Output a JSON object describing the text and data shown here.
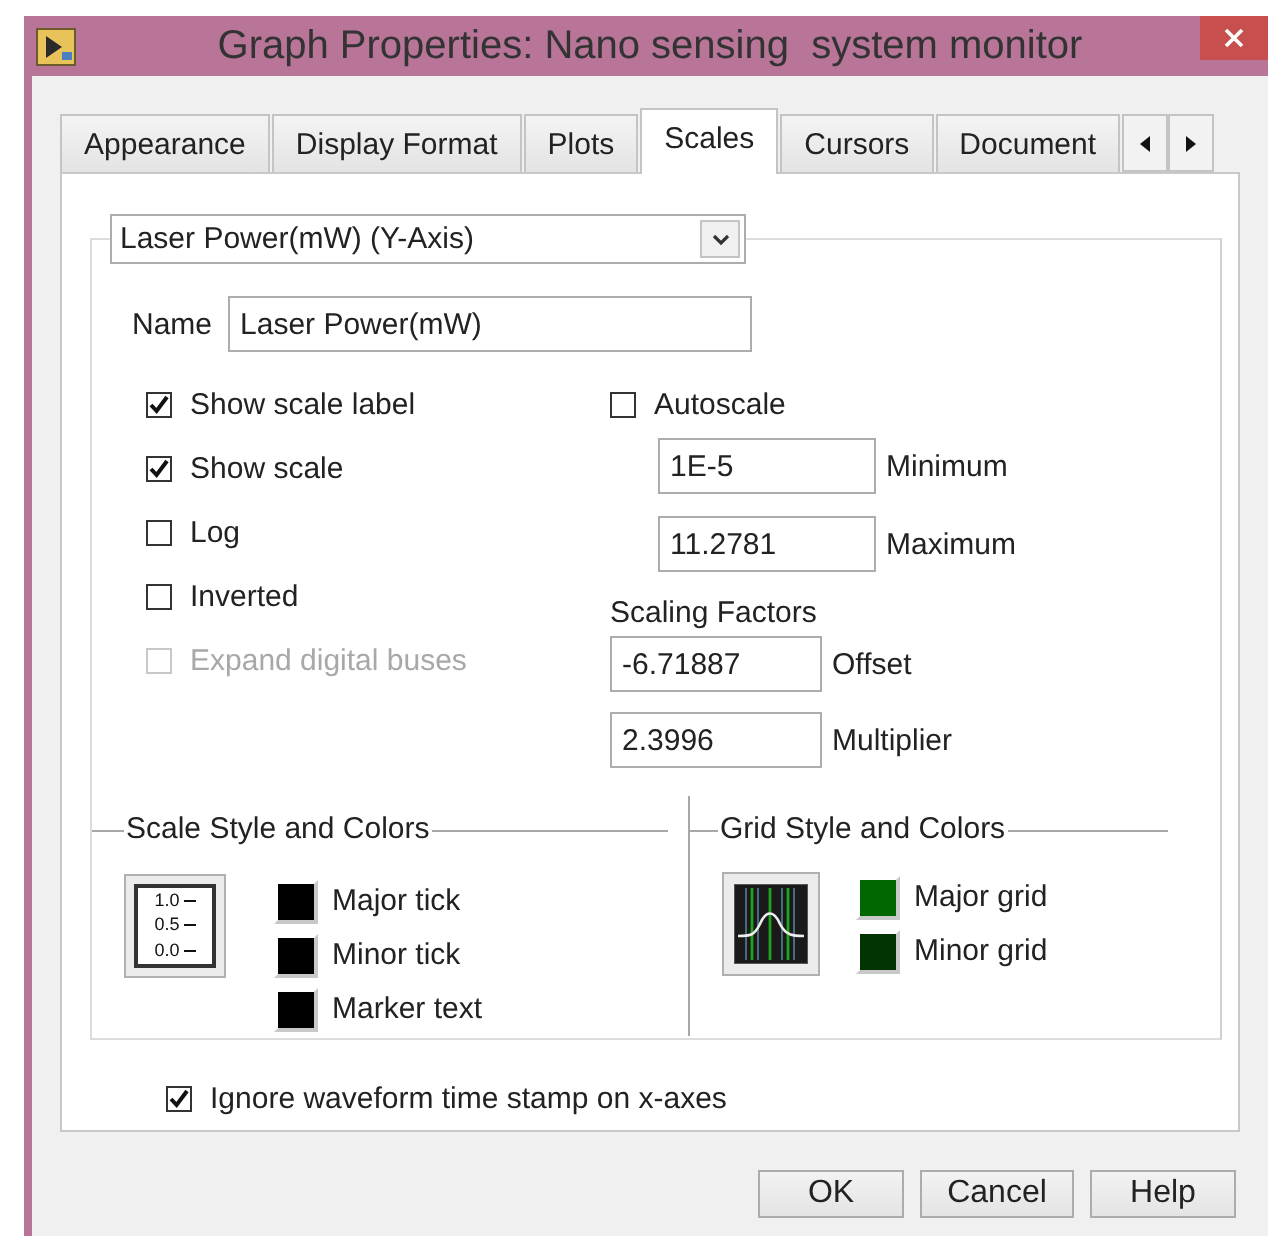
{
  "window": {
    "title": "Graph Properties: Nano sensing  system monitor"
  },
  "tabs": [
    {
      "label": "Appearance",
      "selected": false
    },
    {
      "label": "Display Format",
      "selected": false
    },
    {
      "label": "Plots",
      "selected": false
    },
    {
      "label": "Scales",
      "selected": true
    },
    {
      "label": "Cursors",
      "selected": false
    },
    {
      "label": "Document",
      "selected": false
    }
  ],
  "axis_select": {
    "value": "Laser Power(mW) (Y-Axis)"
  },
  "name": {
    "label": "Name",
    "value": "Laser Power(mW)"
  },
  "options": [
    {
      "label": "Show scale label",
      "checked": true,
      "disabled": false
    },
    {
      "label": "Show scale",
      "checked": true,
      "disabled": false
    },
    {
      "label": "Log",
      "checked": false,
      "disabled": false
    },
    {
      "label": "Inverted",
      "checked": false,
      "disabled": false
    },
    {
      "label": "Expand digital buses",
      "checked": false,
      "disabled": true
    }
  ],
  "autoscale": {
    "label": "Autoscale",
    "checked": false
  },
  "range": [
    {
      "value": "1E-5",
      "label": "Minimum"
    },
    {
      "value": "11.2781",
      "label": "Maximum"
    }
  ],
  "scaling_factors": {
    "title": "Scaling Factors",
    "fields": [
      {
        "value": "-6.71887",
        "label": "Offset"
      },
      {
        "value": "2.3996",
        "label": "Multiplier"
      }
    ]
  },
  "scale_style": {
    "title": "Scale Style and Colors",
    "preview_labels": [
      "1.0",
      "0.5",
      "0.0"
    ],
    "colors": [
      {
        "label": "Major tick",
        "color": "#000000"
      },
      {
        "label": "Minor tick",
        "color": "#000000"
      },
      {
        "label": "Marker text",
        "color": "#000000"
      }
    ]
  },
  "grid_style": {
    "title": "Grid Style and Colors",
    "colors": [
      {
        "label": "Major grid",
        "color": "#006600"
      },
      {
        "label": "Minor grid",
        "color": "#003300"
      }
    ]
  },
  "ignore_timestamp": {
    "label": "Ignore waveform time stamp on x-axes",
    "checked": true
  },
  "buttons": [
    "OK",
    "Cancel",
    "Help"
  ]
}
